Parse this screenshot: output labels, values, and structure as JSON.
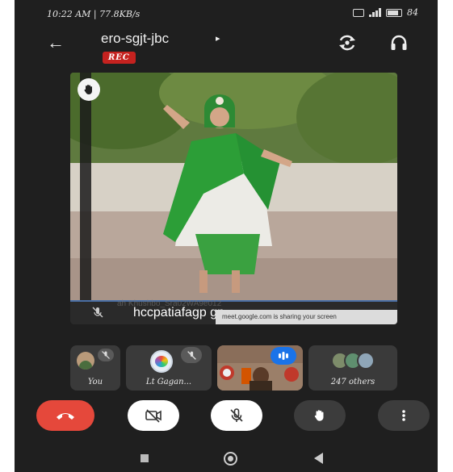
{
  "status_bar": {
    "time_speed": "10:22 AM | 77.8KB/s",
    "battery": "84"
  },
  "header": {
    "meeting_code": "ero-sgjt-jbc",
    "caret": "▸",
    "rec_label": "REC",
    "back_glyph": "←"
  },
  "stage": {
    "presenter_name": "hccpatiafagp gp",
    "ghost_text": "ah Khushbo_Sra02WA9e012",
    "share_banner": "meet.google.com is sharing your screen"
  },
  "participants": [
    {
      "label": "You",
      "muted": true
    },
    {
      "label": "Lt Gagan...",
      "muted": true
    },
    {
      "label": "",
      "speaking": true
    },
    {
      "label": "247 others"
    }
  ],
  "controls": [
    "end-call",
    "camera-off",
    "mic-off",
    "raise-hand",
    "more-options"
  ],
  "colors": {
    "end_call": "#e5483b",
    "rec": "#c5221f",
    "speaking": "#1a73e8",
    "background": "#1f1f1f"
  }
}
